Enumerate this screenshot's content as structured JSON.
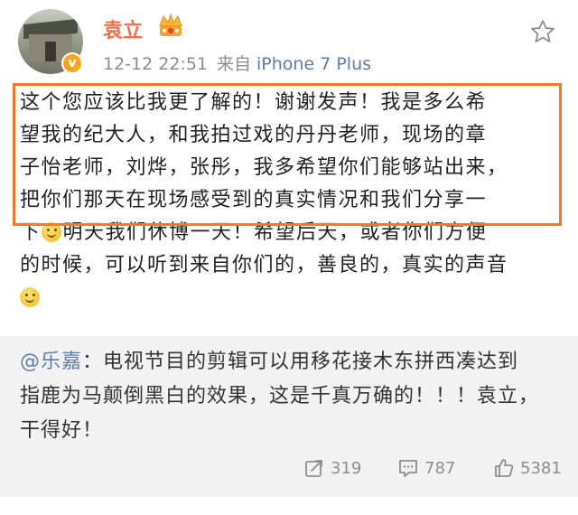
{
  "post": {
    "username": "袁立",
    "time": "12-12 22:51",
    "source_prefix": "来自",
    "device": "iPhone 7 Plus",
    "lines": [
      "这个您应该比我更了解的！谢谢发声！我是多么希",
      "望我的纪大人，和我拍过戏的丹丹老师，现场的章",
      "子怡老师，刘烨，张彤，我多希望你们能够站出来，",
      "把你们那天在现场感受到的真实情况和我们分享一"
    ],
    "line5_a": "下",
    "line5_b": "明天我们休博一天！希望后天，或者你们方便",
    "line6": "的时候，可以听到来自你们的，善良的，真实的声音"
  },
  "retweet": {
    "user": "@乐嘉",
    "line1_rest": "：电视节目的剪辑可以用移花接木东拼西凑达到",
    "line2": "指鹿为马颠倒黑白的效果，这是千真万确的！！！袁立，",
    "line3": "干得好！"
  },
  "actions": {
    "repost_count": "319",
    "comment_count": "787",
    "like_count": "5381"
  },
  "colors": {
    "username": "#eb7350",
    "link": "#5d7ea8",
    "highlight_border": "#f07a2b",
    "retweet_bg": "#f2f2f2",
    "meta": "#8d8d8d"
  },
  "icons": [
    "verified-badge-icon",
    "crown-icon",
    "star-icon",
    "smile-emoji-icon",
    "repost-icon",
    "comment-icon",
    "like-icon"
  ]
}
